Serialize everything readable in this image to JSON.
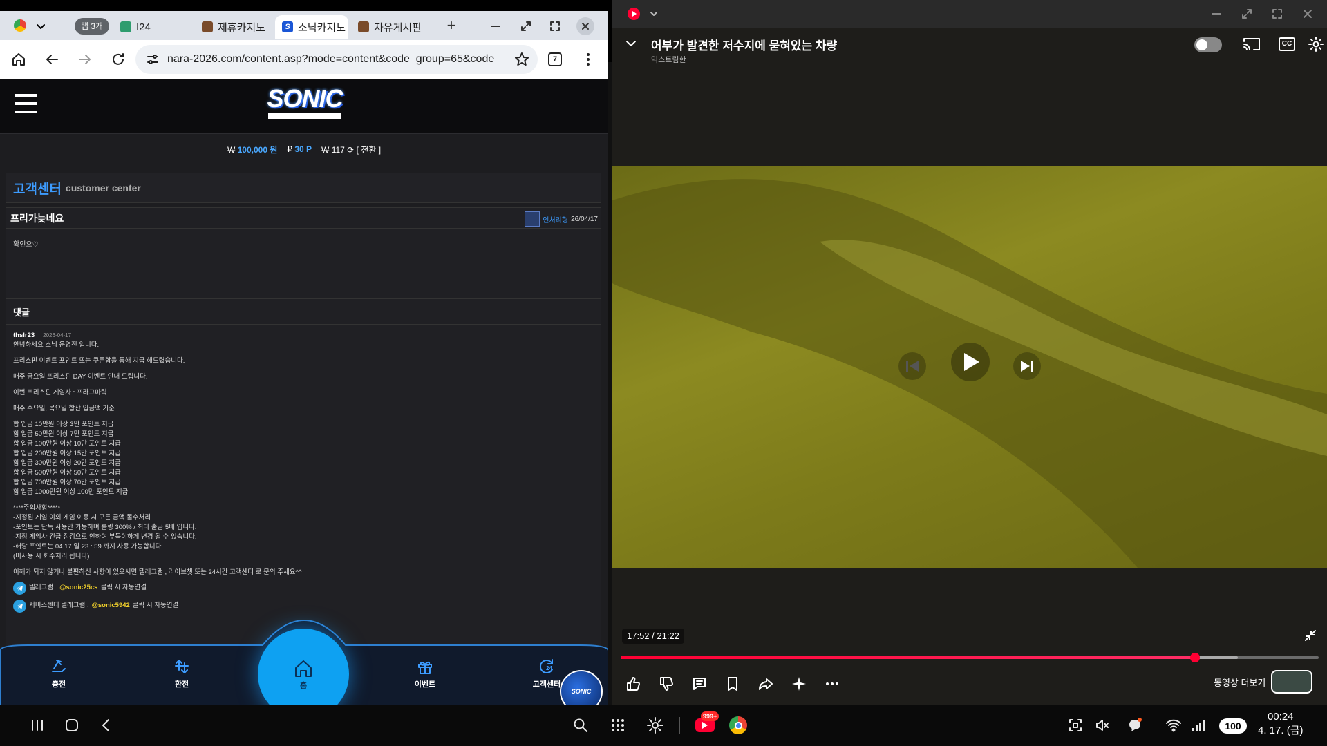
{
  "browser": {
    "tab_group": "탭 3개",
    "tabs": [
      {
        "title": "I24",
        "color": "#2e9c6e"
      },
      {
        "title": "제휴카지노",
        "color": "#7a4b2a"
      },
      {
        "title": "소닉카지노",
        "color": "#1a56d6"
      },
      {
        "title": "자유게시판",
        "color": "#7a4b2a"
      }
    ],
    "new_tab": "+",
    "url": "nara-2026.com/content.asp?mode=content&code_group=65&code",
    "tab_switch_count": "7"
  },
  "site": {
    "logo_text": "SONIC",
    "balance": {
      "won": "100,000 원",
      "points": "30 P",
      "extra": "117",
      "convert": "[ 전환 ]"
    },
    "section_title": "고객센터",
    "section_sub": "customer center",
    "post": {
      "title": "프리가늦네요",
      "author": "인처리형",
      "date": "26/04/17",
      "body": "확인요♡"
    },
    "comments_label": "댓글",
    "comment": {
      "author": "thslr23",
      "date": "2026-04-17",
      "lines": [
        "안녕하세요 소닉 운영진 입니다.",
        "프리스핀 이벤트 포인트 또는 쿠폰함을 통해 지급 해드렸습니다.",
        "매주 금요일 프리스핀 DAY 이벤트 안내 드립니다.",
        "이번 프리스핀 게임사 : 프라그마틱",
        "매주 수요일, 목요일 합산 입금액 기준"
      ],
      "tiers": [
        "합 입금 10만원 이상 3만 포인트 지급",
        "합 입금 50만원 이상 7만 포인트 지급",
        "합 입금 100만원 이상 10만 포인트 지급",
        "합 입금 200만원 이상 15만 포인트 지급",
        "합 입금 300만원 이상 20만 포인트 지급",
        "합 입금 500만원 이상 50만 포인트 지급",
        "합 입금 700만원 이상 70만 포인트 지급",
        "합 입금 1000만원 이상 100만 포인트 지급"
      ],
      "notes": [
        "****주의사항*****",
        "-지정된 게임 이외 게임 이용 시 모든 금액 몰수처리",
        "-포인트는 단독 사용만 가능하며 롤링 300% / 최대 출금 5배 입니다.",
        "-지정 게임사 긴급 점검으로 인하여 부득이하게 변경 될 수 있습니다.",
        "-해당 포인트는 04.17 일 23 : 59 까지 사용 가능합니다.",
        "(미사용 시 회수처리 됩니다)"
      ],
      "footer": "이해가 되지 않거나 불편하신 사항이 있으시면 텔레그램 , 라이브챗 또는 24시간 고객센터 로 문의 주세요^^",
      "tg1_prefix": "텔레그램 :",
      "tg1_handle": "@sonic25cs",
      "tg1_suffix": "클릭 시 자동연결",
      "tg2_prefix": "서비스센터 텔레그램 :",
      "tg2_handle": "@sonic5942",
      "tg2_suffix": "클릭 시 자동연결"
    },
    "nav": {
      "charge": "충전",
      "exchange": "환전",
      "home": "홈",
      "event": "이벤트",
      "support": "고객센터"
    },
    "badge": "SONIC"
  },
  "youtube": {
    "title": "어부가 발견한 저수지에 묻혀있는 차량",
    "channel": "익스트림한",
    "time": "17:52 / 21:22",
    "progress": 0.823,
    "buffered": 0.884,
    "more_label": "동영상 더보기",
    "accent": "#ff0033"
  },
  "system": {
    "youtube_badge": "999+",
    "battery": "100",
    "time": "00:24",
    "date": "4. 17. (금)"
  }
}
